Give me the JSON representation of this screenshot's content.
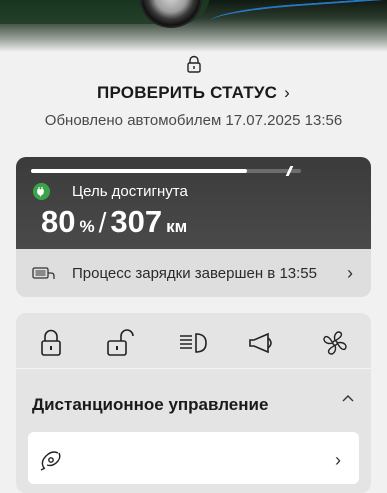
{
  "header": {
    "lock_icon": "lock-icon",
    "status_link_label": "ПРОВЕРИТЬ СТАТУС",
    "status_link_chevron": "›",
    "updated_text": "Обновлено автомобилем 17.07.2025 13:56"
  },
  "charging": {
    "progress_fraction": 0.8,
    "target_fraction": 0.95,
    "goal_icon": "charge-plug-icon",
    "goal_label": "Цель достигнута",
    "soc_value": "80",
    "soc_unit": "%",
    "separator": "/",
    "range_value": "307",
    "range_unit": "км",
    "status_icon": "charging-cable-icon",
    "status_text": "Процесс зарядки завершен в 13:55",
    "status_chevron": "›",
    "accent_color": "#3aa34a"
  },
  "remote": {
    "controls": [
      {
        "name": "lock-icon"
      },
      {
        "name": "unlock-icon"
      },
      {
        "name": "headlight-icon"
      },
      {
        "name": "horn-icon"
      },
      {
        "name": "fan-icon"
      }
    ],
    "title": "Дистанционное управление",
    "collapse_icon": "chevron-up-icon",
    "first_item_icon": "remote-climate-icon",
    "first_item_chevron": "›"
  }
}
